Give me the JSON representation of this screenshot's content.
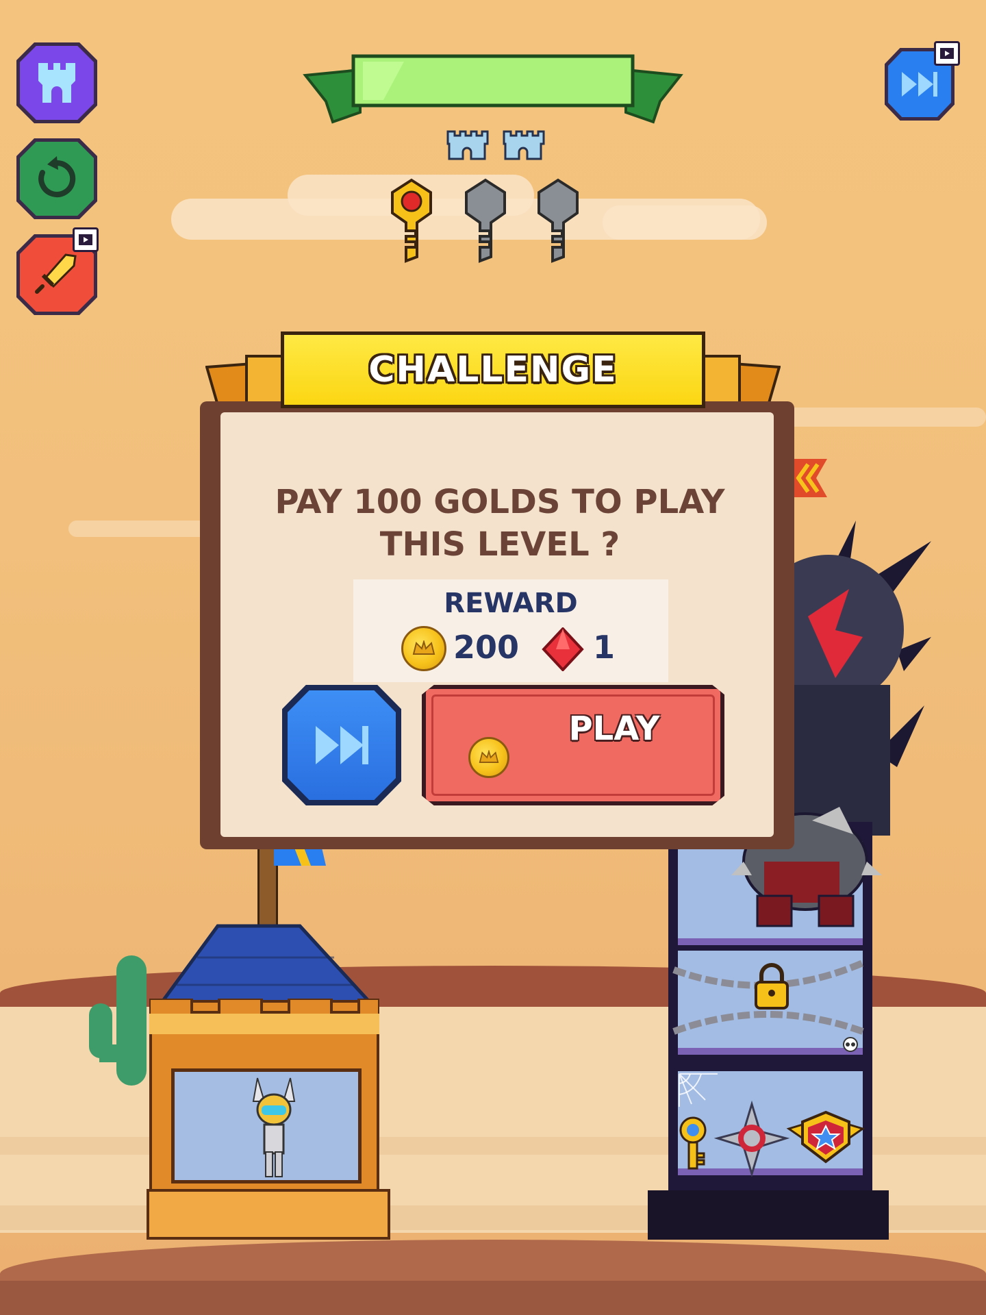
{
  "hud": {
    "castle_menu_icon": "castle-icon",
    "restart_icon": "restart-icon",
    "weapon_icon": "sword-icon",
    "skip_icon": "fast-forward-icon",
    "video_ad_icon": "film-icon",
    "keys_collected": 1,
    "keys_total": 3
  },
  "dialog": {
    "title": "CHALLENGE",
    "question_line1": "PAY 100 GOLDS TO PLAY",
    "question_line2": "THIS LEVEL ?",
    "reward_label": "REWARD",
    "reward_gold": "200",
    "reward_gems": "1",
    "play_label": "PLAY"
  },
  "colors": {
    "sky": "#f4c47e",
    "castle_button": "#7b47e8",
    "restart_button": "#2e9a53",
    "weapon_button": "#f04e3a",
    "skip_button": "#2a7ff0",
    "play_button": "#f16a62",
    "title_banner": "#fbd613",
    "text_brown": "#6b4437",
    "text_navy": "#263566"
  }
}
